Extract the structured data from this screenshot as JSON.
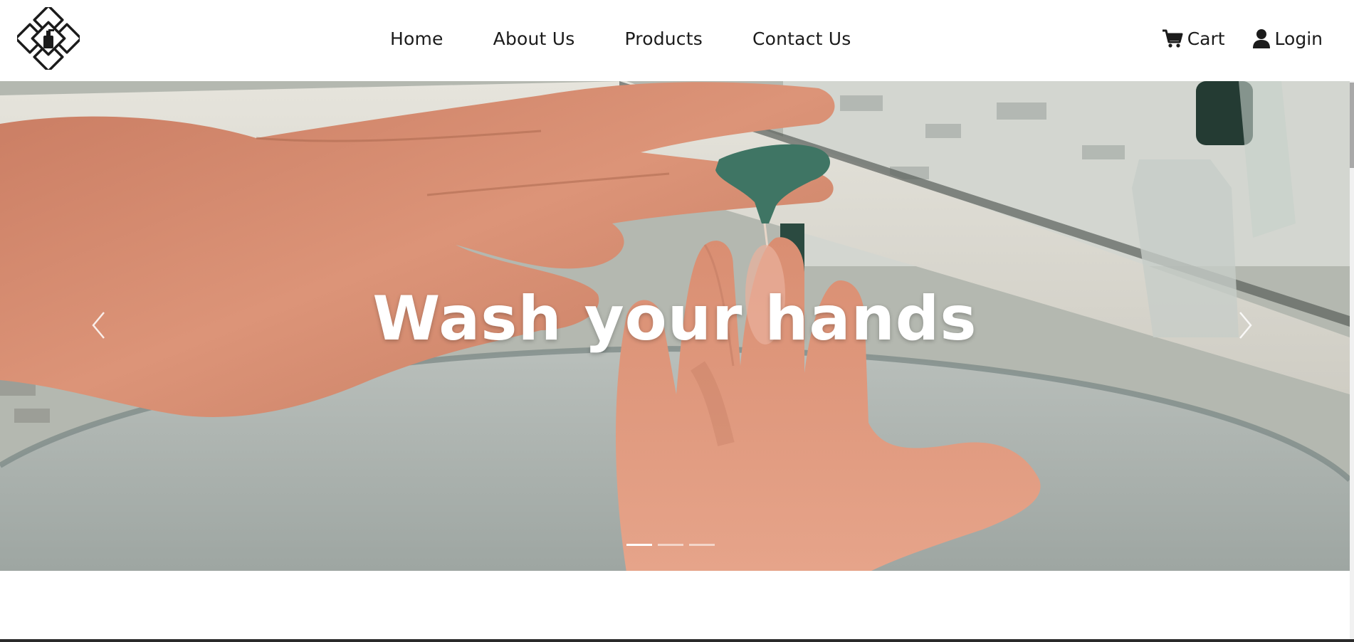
{
  "brand": {
    "logo_icon": "soap-dispenser-diamond-logo-icon"
  },
  "nav": {
    "links": [
      {
        "label": "Home"
      },
      {
        "label": "About Us"
      },
      {
        "label": "Products"
      },
      {
        "label": "Contact Us"
      }
    ],
    "cart": {
      "label": "Cart",
      "icon": "cart-icon"
    },
    "login": {
      "label": "Login",
      "icon": "user-icon"
    }
  },
  "hero": {
    "caption": "Wash your hands",
    "prev_icon": "chevron-left-icon",
    "next_icon": "chevron-right-icon",
    "indicators": [
      {
        "active": true
      },
      {
        "active": false
      },
      {
        "active": false
      }
    ]
  },
  "colors": {
    "text": "#1b1b1b",
    "caption": "#ffffff",
    "skin": "#d58a6e",
    "pump": "#3f7564"
  }
}
